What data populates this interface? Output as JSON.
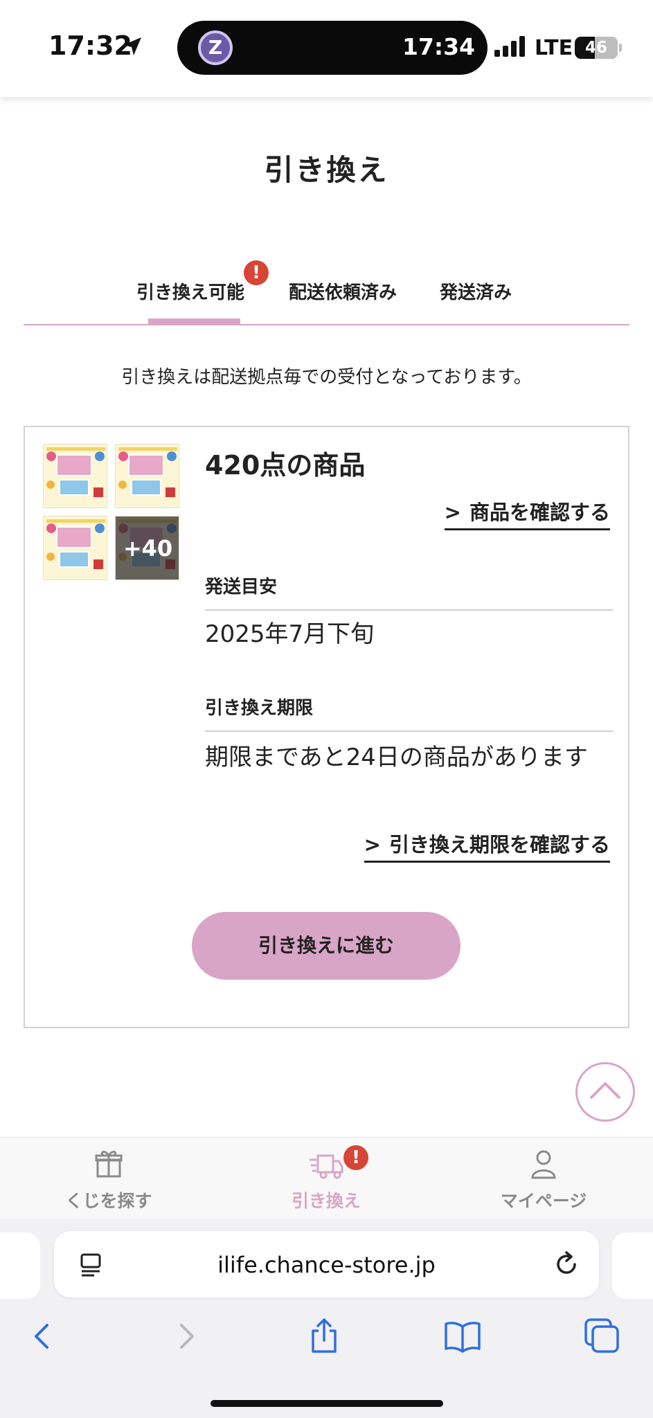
{
  "status_bar": {
    "time": "17:32",
    "island_badge": "Z",
    "island_time": "17:34",
    "network": "LTE",
    "battery": "46"
  },
  "page": {
    "title": "引き換え"
  },
  "tabs": [
    {
      "label": "引き換え可能",
      "active": true,
      "alert": "!"
    },
    {
      "label": "配送依頼済み",
      "active": false
    },
    {
      "label": "発送済み",
      "active": false
    }
  ],
  "notice": "引き換えは配送拠点毎での受付となっております。",
  "card": {
    "more_count": "+40",
    "item_count": "420点の商品",
    "view_items_link": "商品を確認する",
    "shipping_label": "発送目安",
    "shipping_value": "2025年7月下旬",
    "deadline_label": "引き換え期限",
    "deadline_value": "期限まであと24日の商品があります",
    "deadline_link": "引き換え期限を確認する",
    "proceed_button": "引き換えに進む"
  },
  "bottom_nav": {
    "items": [
      {
        "label": "くじを探す",
        "icon": "gift-icon",
        "active": false
      },
      {
        "label": "引き換え",
        "icon": "delivery-truck-icon",
        "active": true,
        "alert": "!"
      },
      {
        "label": "マイページ",
        "icon": "person-icon",
        "active": false
      }
    ]
  },
  "browser": {
    "url": "ilife.chance-store.jp"
  },
  "colors": {
    "accent": "#d9a5c6",
    "alert": "#d64535",
    "inactive": "#8a8a8a"
  }
}
